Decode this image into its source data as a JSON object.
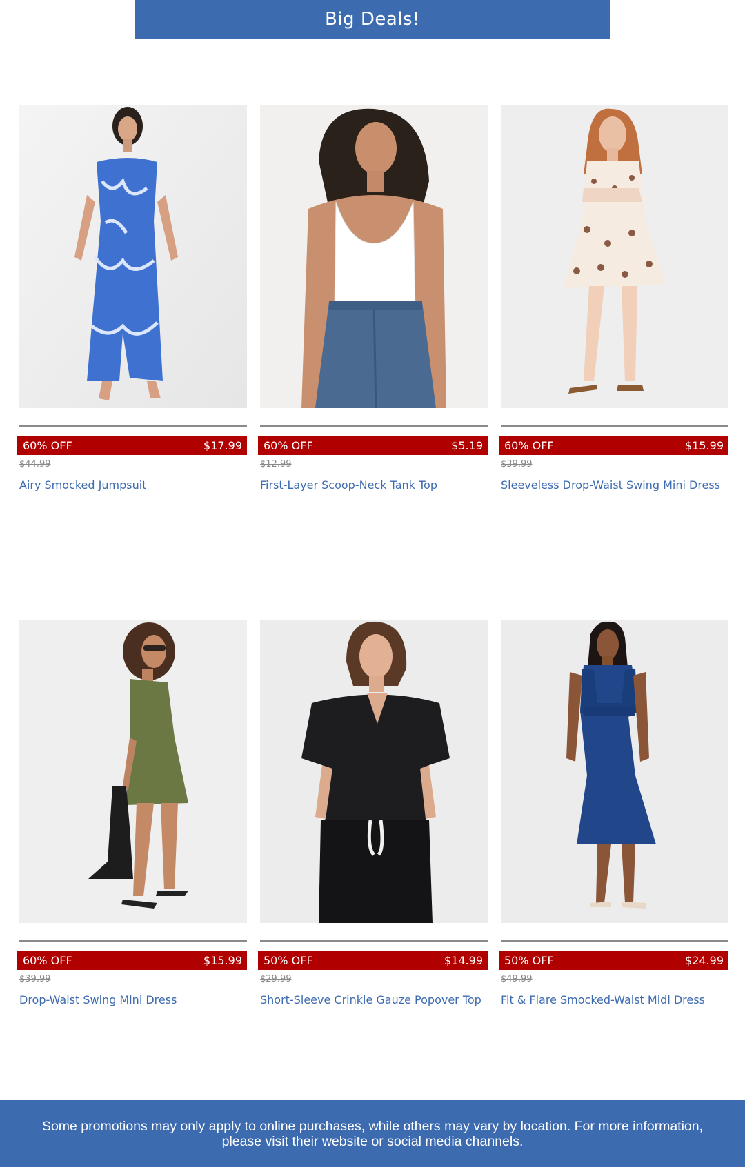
{
  "banner": {
    "title": "Big Deals!"
  },
  "products": [
    {
      "discount": "60% OFF",
      "sale_price": "$17.99",
      "original_price": "$44.99",
      "name": "Airy Smocked Jumpsuit",
      "image": "woman-in-blue-floral-jumpsuit"
    },
    {
      "discount": "60% OFF",
      "sale_price": "$5.19",
      "original_price": "$12.99",
      "name": "First-Layer Scoop-Neck Tank Top",
      "image": "woman-in-white-tank-and-jeans"
    },
    {
      "discount": "60% OFF",
      "sale_price": "$15.99",
      "original_price": "$39.99",
      "name": "Sleeveless Drop-Waist Swing Mini Dress",
      "image": "woman-in-floral-mini-dress"
    },
    {
      "discount": "60% OFF",
      "sale_price": "$15.99",
      "original_price": "$39.99",
      "name": "Drop-Waist Swing Mini Dress",
      "image": "woman-in-olive-mini-dress-with-bag"
    },
    {
      "discount": "50% OFF",
      "sale_price": "$14.99",
      "original_price": "$29.99",
      "name": "Short-Sleeve Crinkle Gauze Popover Top",
      "image": "woman-in-black-popover-top"
    },
    {
      "discount": "50% OFF",
      "sale_price": "$24.99",
      "original_price": "$49.99",
      "name": "Fit & Flare Smocked-Waist Midi Dress",
      "image": "woman-in-navy-midi-dress"
    }
  ],
  "footer": {
    "disclaimer": "Some promotions may only apply to online purchases, while others may vary by location. For more information, please visit their website or social media channels."
  },
  "colors": {
    "brand_blue": "#3d6bb0",
    "deal_red": "#b00000",
    "strike_gray": "#8a8a8a"
  }
}
